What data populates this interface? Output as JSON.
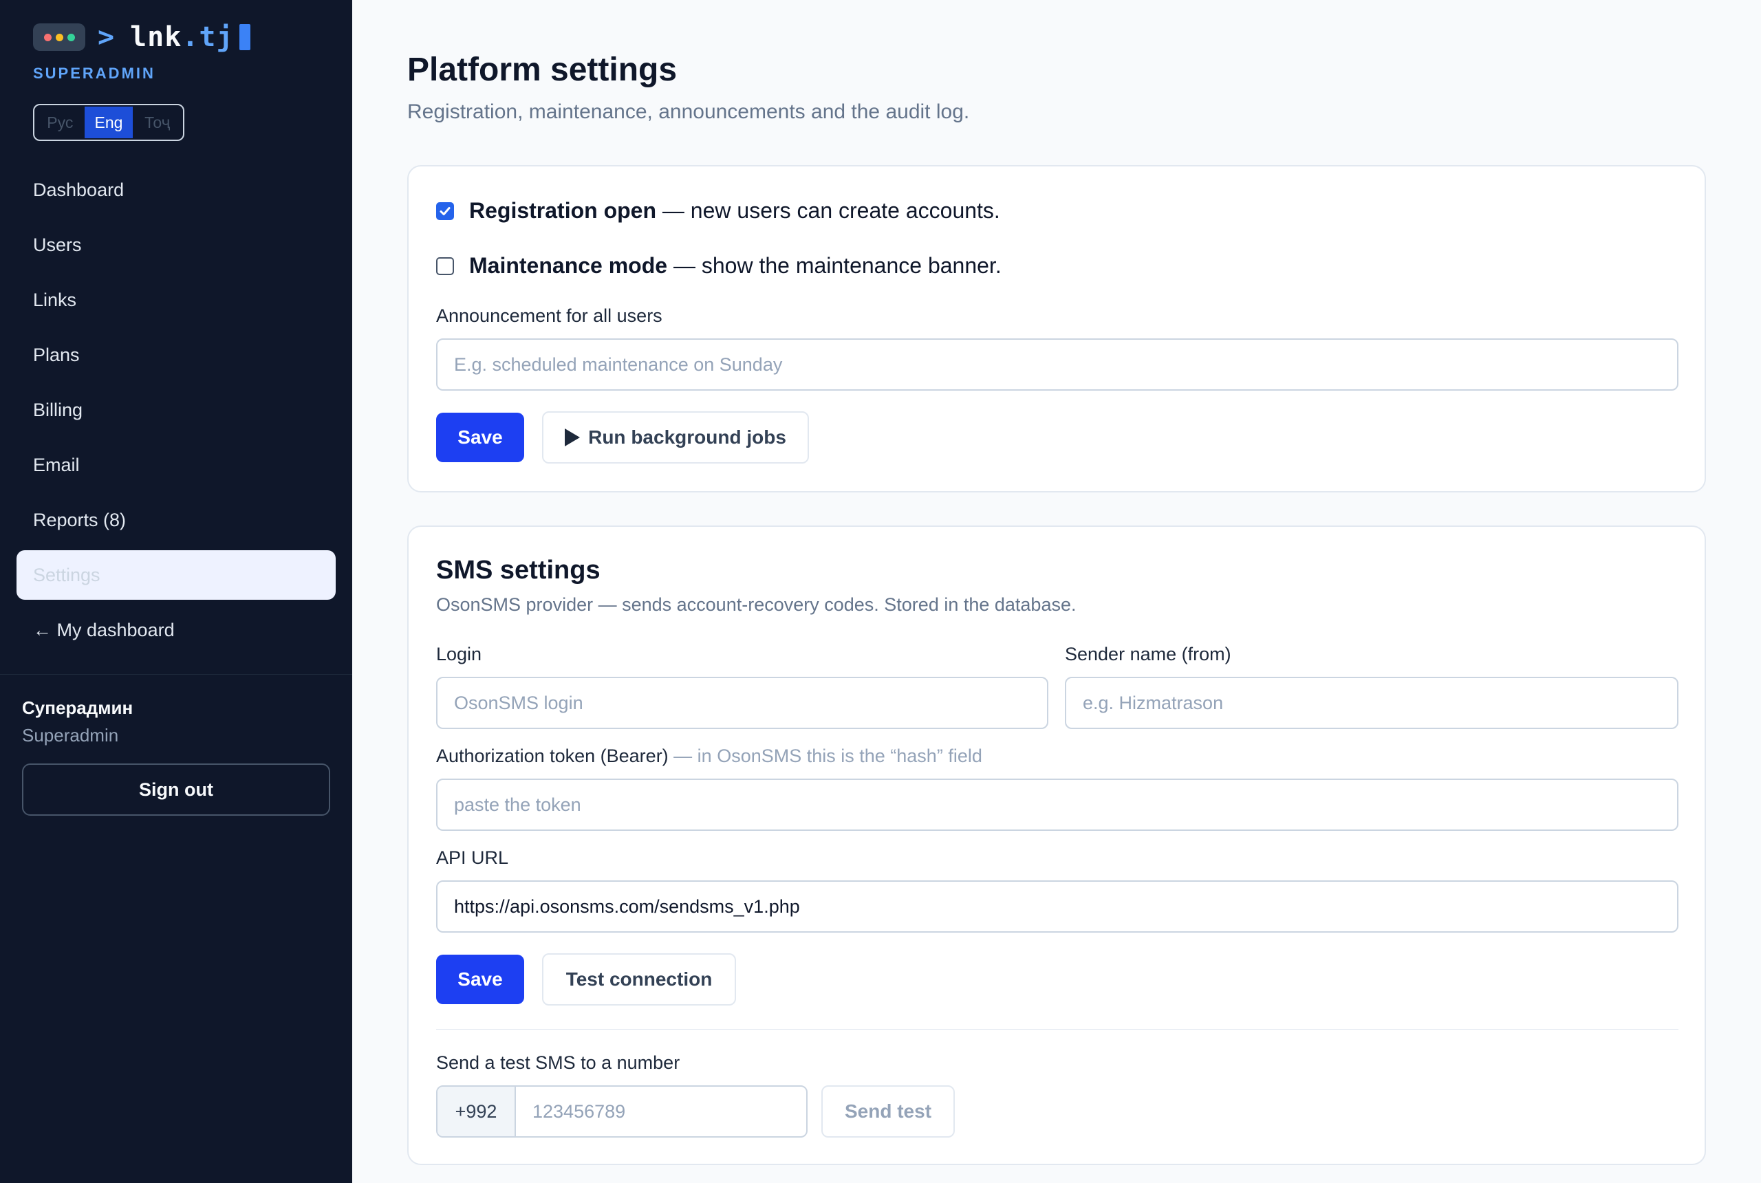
{
  "brand": {
    "prompt": ">",
    "name": "lnk",
    "tld": ".tj",
    "role_tag": "SUPERADMIN",
    "dot_colors": [
      "#f87171",
      "#fbbf24",
      "#34d399"
    ]
  },
  "language_switch": {
    "options": [
      "Рус",
      "Eng",
      "Тоҷ"
    ],
    "active": "Eng"
  },
  "nav": {
    "items": [
      {
        "label": "Dashboard"
      },
      {
        "label": "Users"
      },
      {
        "label": "Links"
      },
      {
        "label": "Plans"
      },
      {
        "label": "Billing"
      },
      {
        "label": "Email"
      },
      {
        "label": "Reports (8)"
      },
      {
        "label": "Settings",
        "active": true
      },
      {
        "label": "← My dashboard"
      }
    ]
  },
  "user": {
    "name": "Суперадмин",
    "role": "Superadmin",
    "signout_label": "Sign out"
  },
  "page": {
    "title": "Platform settings",
    "subtitle": "Registration, maintenance, announcements and the audit log."
  },
  "platform": {
    "registration": {
      "title": "Registration open",
      "desc": " — new users can create accounts.",
      "checked": true
    },
    "maintenance": {
      "title": "Maintenance mode",
      "desc": " — show the maintenance banner.",
      "checked": false
    },
    "announcement_label": "Announcement for all users",
    "announcement_placeholder": "E.g. scheduled maintenance on Sunday",
    "save_label": "Save",
    "run_jobs_label": "Run background jobs"
  },
  "sms": {
    "title": "SMS settings",
    "subtitle": "OsonSMS provider — sends account-recovery codes. Stored in the database.",
    "login_label": "Login",
    "login_placeholder": "OsonSMS login",
    "sender_label": "Sender name (from)",
    "sender_placeholder": "e.g. Hizmatrason",
    "token_label": "Authorization token (Bearer)",
    "token_hint": " — in OsonSMS this is the “hash” field",
    "token_placeholder": "paste the token",
    "api_url_label": "API URL",
    "api_url_value": "https://api.osonsms.com/sendsms_v1.php",
    "save_label": "Save",
    "test_connection_label": "Test connection",
    "test_sms_label": "Send a test SMS to a number",
    "phone_prefix": "+992",
    "phone_placeholder": "123456789",
    "send_test_label": "Send test"
  },
  "colors": {
    "sidebar_bg": "#0f172a",
    "accent": "#1d3ff2",
    "brand_blue": "#60a5fa"
  }
}
